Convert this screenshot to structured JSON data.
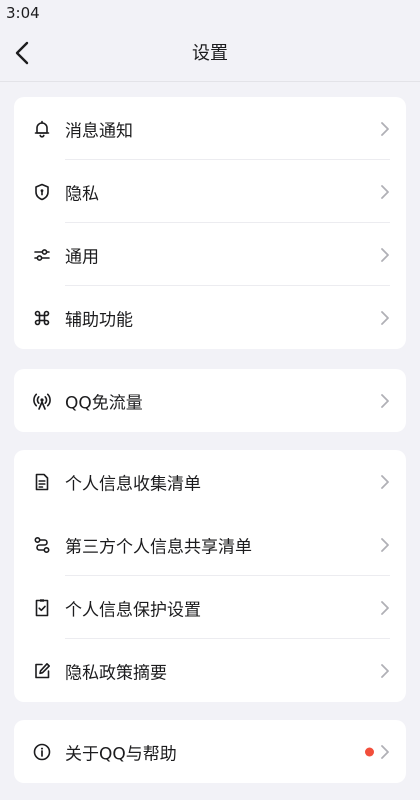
{
  "status_bar": {
    "time": "3:04"
  },
  "header": {
    "title": "设置"
  },
  "colors": {
    "background": "#f2f2f7",
    "card": "#ffffff",
    "text": "#1c1c1e",
    "chevron": "#b0b0b6",
    "icon": "#1c1c1e",
    "badge": "#f24e3b"
  },
  "groups": [
    {
      "items": [
        {
          "label": "消息通知",
          "icon": "bell-icon"
        },
        {
          "label": "隐私",
          "icon": "shield-icon"
        },
        {
          "label": "通用",
          "icon": "sliders-icon"
        },
        {
          "label": "辅助功能",
          "icon": "command-icon"
        }
      ]
    },
    {
      "items": [
        {
          "label": "QQ免流量",
          "icon": "antenna-icon"
        }
      ]
    },
    {
      "items": [
        {
          "label": "个人信息收集清单",
          "icon": "document-icon"
        },
        {
          "label": "第三方个人信息共享清单",
          "icon": "share-icon"
        },
        {
          "label": "个人信息保护设置",
          "icon": "checkbox-doc-icon"
        },
        {
          "label": "隐私政策摘要",
          "icon": "edit-icon"
        }
      ]
    },
    {
      "items": [
        {
          "label": "关于QQ与帮助",
          "icon": "info-icon",
          "badge": true
        }
      ]
    }
  ]
}
